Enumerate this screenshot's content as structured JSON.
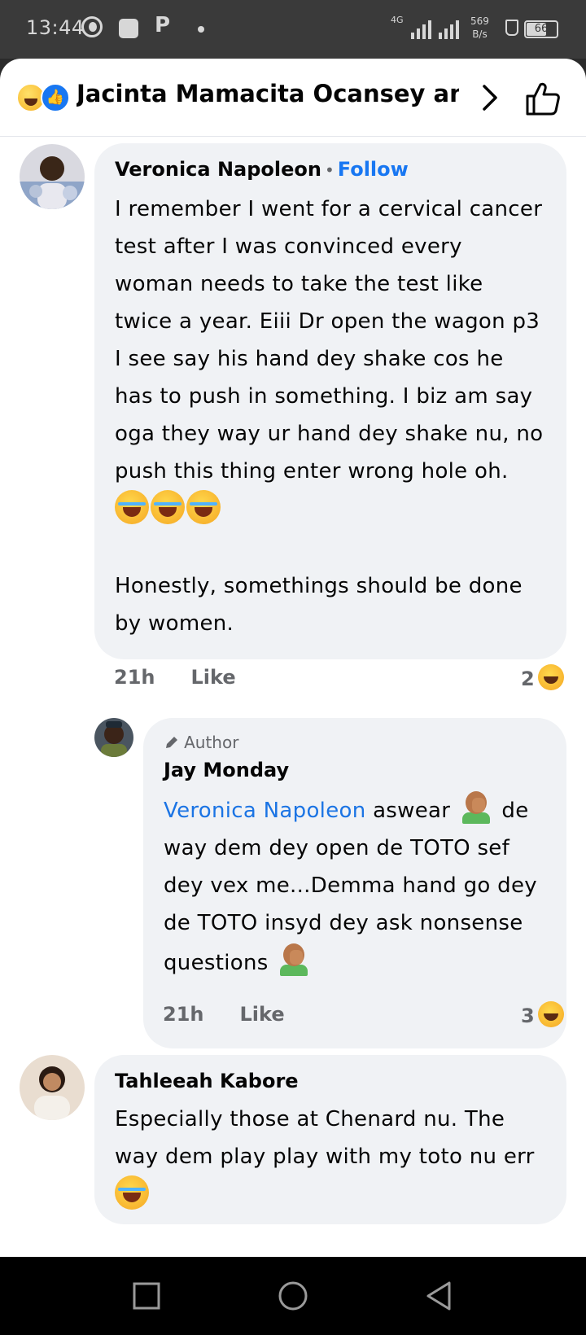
{
  "status_bar": {
    "time": "13:44",
    "network": "4G",
    "speed_value": "569",
    "speed_unit": "B/s",
    "battery": "66"
  },
  "header": {
    "title": "Jacinta Mamacita Ocansey and..."
  },
  "comments": [
    {
      "author": "Veronica Napoleon",
      "follow_label": "Follow",
      "paragraphs": [
        "I remember I went for a cervical cancer test after I was convinced every woman needs to take the test like twice a year. Eiii Dr open the wagon p3 I see say his hand dey shake cos he has to push in something.  I biz am say oga they way ur hand dey shake nu, no push this thing enter wrong hole oh.",
        "Honestly,  somethings should be done by women."
      ],
      "time": "21h",
      "like_label": "Like",
      "reaction_count": "2"
    },
    {
      "badge": "Author",
      "author": "Jay Monday",
      "mention": "Veronica Napoleon",
      "text_a": "aswear",
      "text_b": "de way dem dey open de TOTO sef dey vex me...Demma hand go dey de TOTO insyd dey ask nonsense questions",
      "time": "21h",
      "like_label": "Like",
      "reaction_count": "3"
    },
    {
      "author": "Tahleeah Kabore",
      "text": "Especially those at  Chenard nu. The way dem play play with my toto nu err"
    }
  ],
  "icons": {
    "back": "chevron-right-icon",
    "like": "thumbs-up-icon"
  }
}
